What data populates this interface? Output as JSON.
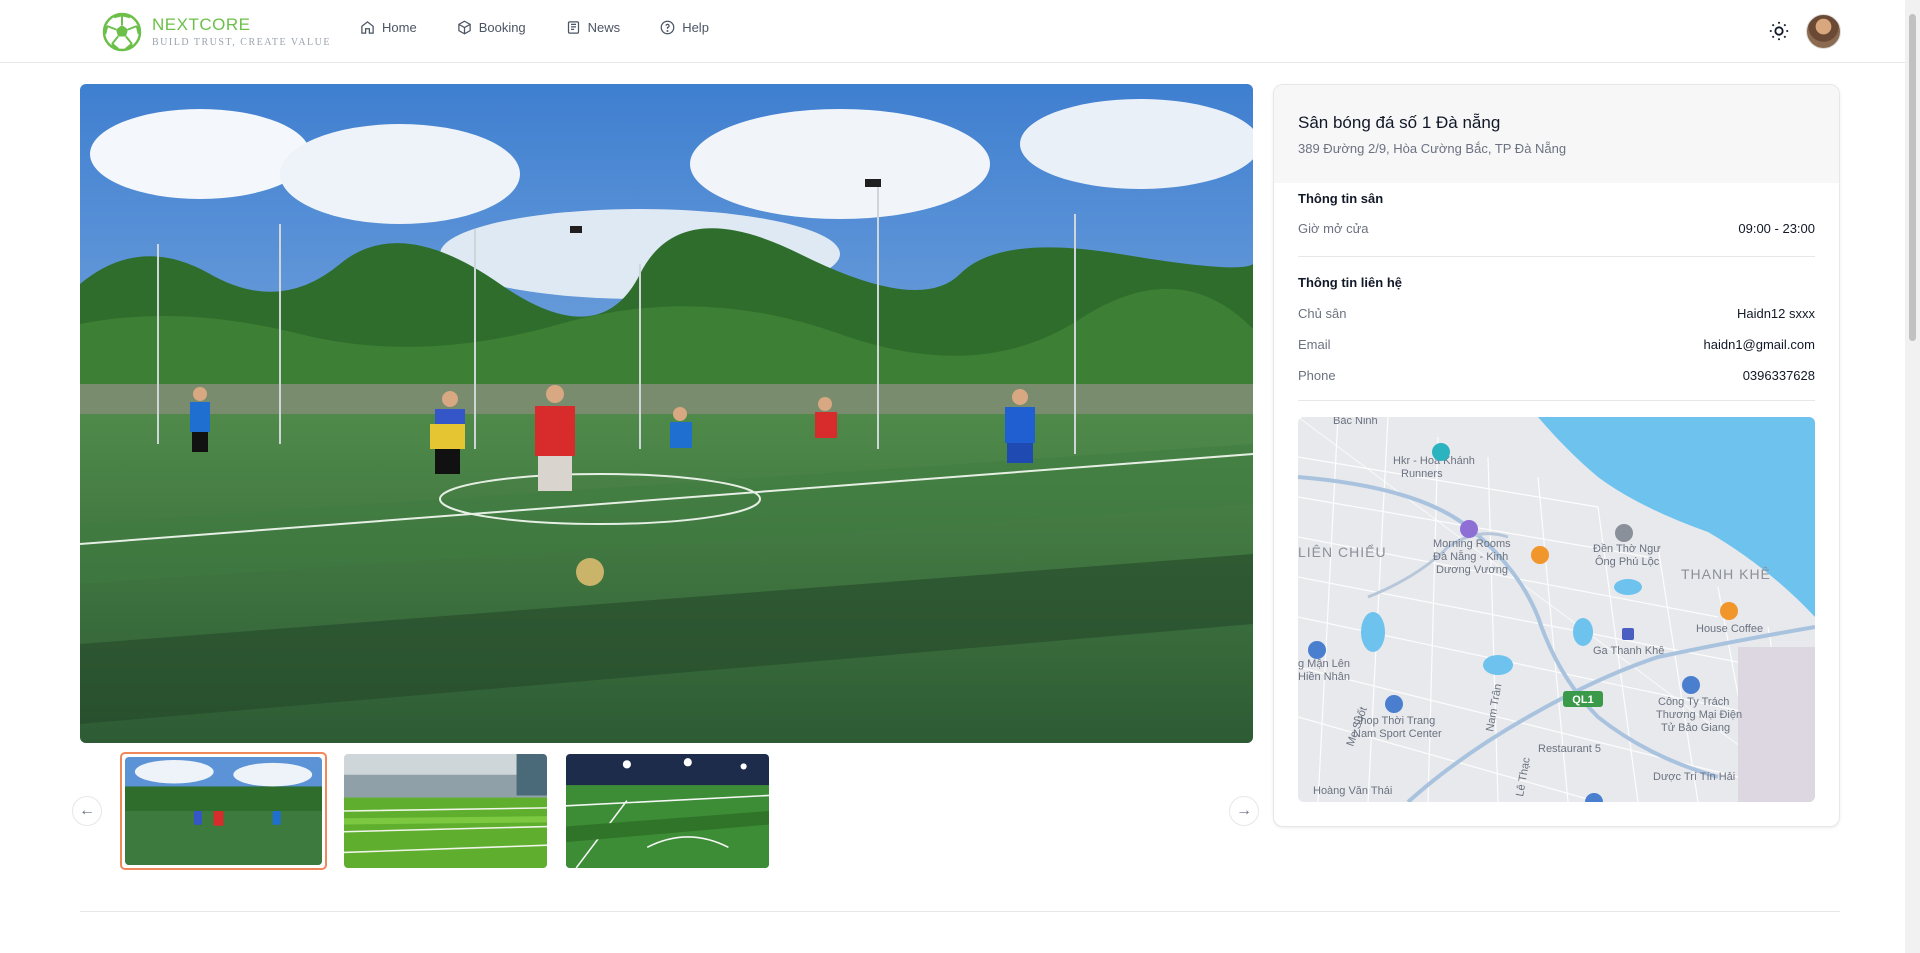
{
  "brand": {
    "name": "NEXTCORE",
    "tagline": "BUILD TRUST, CREATE VALUE",
    "accent": "#6cc04a"
  },
  "nav": [
    {
      "label": "Home",
      "icon": "home-icon"
    },
    {
      "label": "Booking",
      "icon": "box-icon"
    },
    {
      "label": "News",
      "icon": "newspaper-icon"
    },
    {
      "label": "Help",
      "icon": "help-circle-icon"
    }
  ],
  "venue": {
    "name": "Sân bóng đá số 1 Đà nẵng",
    "address": "389 Đường 2/9, Hòa Cường Bắc, TP Đà Nẵng",
    "info_section": "Thông tin sân",
    "hours_label": "Giờ mở cửa",
    "hours_value": "09:00 - 23:00",
    "contact_section": "Thông tin liên hệ",
    "owner_label": "Chủ sân",
    "owner_value": "Haidn12 sxxx",
    "email_label": "Email",
    "email_value": "haidn1@gmail.com",
    "phone_label": "Phone",
    "phone_value": "0396337628"
  },
  "gallery": {
    "count": 3,
    "active_index": 0
  },
  "map": {
    "labels": {
      "bac_ninh": "Bắc Ninh",
      "hkr": "Hkr - Hoa Khánh",
      "runners": "Runners",
      "morning1": "Morning Rooms",
      "morning2": "Đà Nẵng - Kinh",
      "morning3": "Dương Vương",
      "lien_chieu": "LIÊN CHIỂU",
      "den_tho1": "Đền Thờ Ngư",
      "den_tho2": "Ông Phú Lộc",
      "thanh_khe": "THANH KHÊ",
      "house_coffee": "House Coffee",
      "ga": "Ga Thanh Khê",
      "qm1": "g Mận Lên",
      "qm2": "Hiền Nhân",
      "me_suot": "Mẹ Suốt",
      "nam_tran": "Nam Trân",
      "shop1": "Shop Thời Trang",
      "shop2": "Nam Sport Center",
      "ql1": "QL1",
      "cty1": "Công Ty Trách",
      "cty2": "Thương Mại Điện",
      "cty3": "Tử Bảo Giang",
      "restaurant": "Restaurant 5",
      "hoang_van_thai": "Hoàng Văn Thái",
      "le_trong": "Lê Thạc",
      "duoc": "Dược Trí Tín Hải"
    }
  }
}
